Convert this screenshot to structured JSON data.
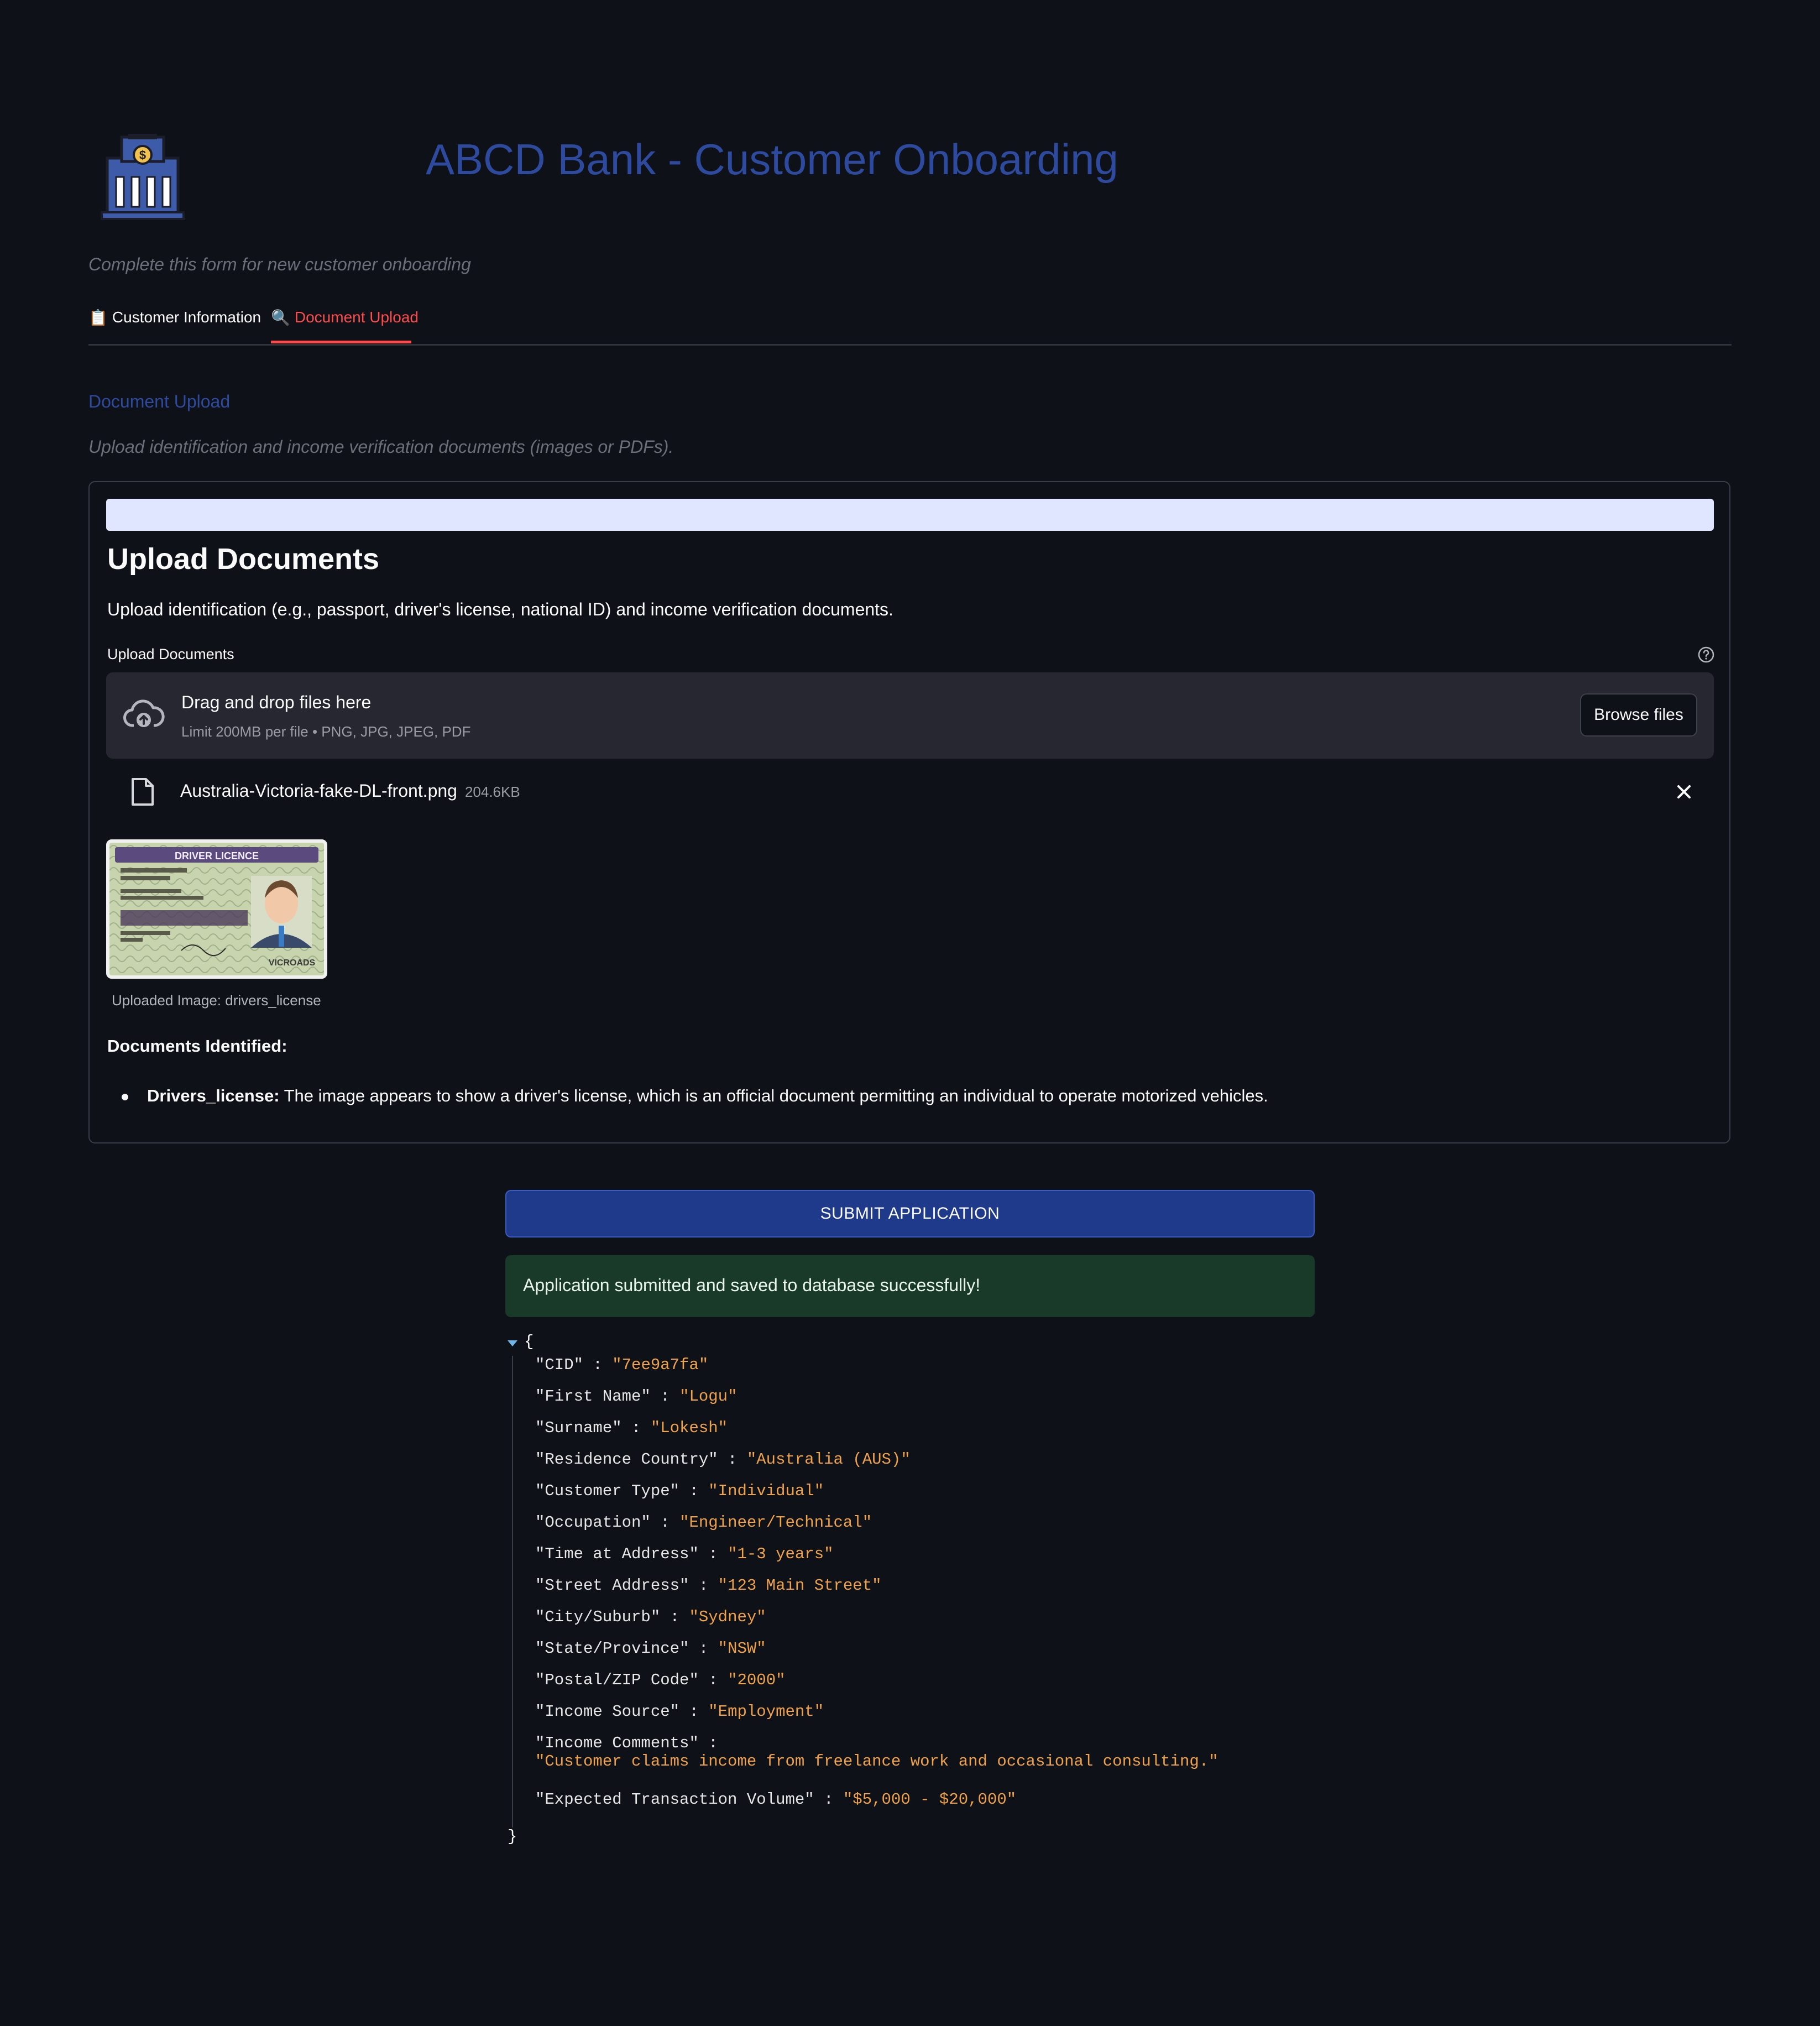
{
  "header": {
    "logo": "bank-building-icon",
    "title": "ABCD Bank - Customer Onboarding",
    "subtitle": "Complete this form for new customer onboarding"
  },
  "tabs": [
    {
      "icon": "📋",
      "label": "Customer Information",
      "active": false
    },
    {
      "icon": "🔍",
      "label": "Document Upload",
      "active": true
    }
  ],
  "section": {
    "heading": "Document Upload",
    "description": "Upload identification and income verification documents (images or PDFs)."
  },
  "upload": {
    "title": "Upload Documents",
    "description": "Upload identification (e.g., passport, driver's license, national ID) and income verification documents.",
    "field_label": "Upload Documents",
    "dropzone_text": "Drag and drop files here",
    "dropzone_limit": "Limit 200MB per file • PNG, JPG, JPEG, PDF",
    "browse_label": "Browse files",
    "file": {
      "name": "Australia-Victoria-fake-DL-front.png",
      "size": "204.6KB"
    },
    "thumbnail_caption": "Uploaded Image: drivers_license",
    "thumbnail_text": {
      "header": "DRIVER LICENCE",
      "brand": "VICROADS"
    },
    "identified_heading": "Documents Identified:",
    "identified_items": [
      {
        "type": "Drivers_license:",
        "description": " The image appears to show a driver's license, which is an official document permitting an individual to operate motorized vehicles."
      }
    ]
  },
  "submit": {
    "label": "SUBMIT APPLICATION",
    "success_message": "Application submitted and saved to database successfully!"
  },
  "json_output": {
    "open": "{",
    "close": "}",
    "rows": [
      {
        "key": "\"CID\"",
        "value": "\"7ee9a7fa\""
      },
      {
        "key": "\"First Name\"",
        "value": "\"Logu\""
      },
      {
        "key": "\"Surname\"",
        "value": "\"Lokesh\""
      },
      {
        "key": "\"Residence Country\"",
        "value": "\"Australia (AUS)\""
      },
      {
        "key": "\"Customer Type\"",
        "value": "\"Individual\""
      },
      {
        "key": "\"Occupation\"",
        "value": "\"Engineer/Technical\""
      },
      {
        "key": "\"Time at Address\"",
        "value": "\"1-3 years\""
      },
      {
        "key": "\"Street Address\"",
        "value": "\"123 Main Street\""
      },
      {
        "key": "\"City/Suburb\"",
        "value": "\"Sydney\""
      },
      {
        "key": "\"State/Province\"",
        "value": "\"NSW\""
      },
      {
        "key": "\"Postal/ZIP Code\"",
        "value": "\"2000\""
      },
      {
        "key": "\"Income Source\"",
        "value": "\"Employment\""
      },
      {
        "key": "\"Income Comments\"",
        "value": "\"Customer claims income from freelance work and occasional consulting.\""
      },
      {
        "key": "\"Expected Transaction Volume\"",
        "value": "\"$5,000 - $20,000\""
      }
    ]
  },
  "colors": {
    "background": "#0e1117",
    "title": "#2e4a9e",
    "active_tab": "#ff4b4b",
    "submit": "#1f3a8a",
    "success_bg": "#193a29",
    "json_value": "#f0a24a"
  }
}
